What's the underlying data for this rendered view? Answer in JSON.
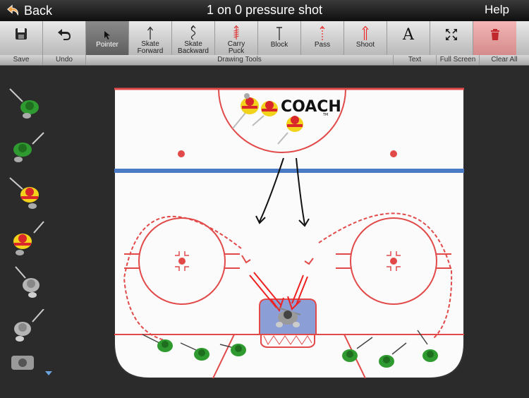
{
  "topbar": {
    "back_label": "Back",
    "title": "1 on 0 pressure shot",
    "help_label": "Help"
  },
  "toolbar": {
    "tools": [
      {
        "label": "Save",
        "icon": "save-icon"
      },
      {
        "label": "Undo",
        "icon": "undo-icon"
      },
      {
        "label": "Pointer",
        "icon": "pointer-icon",
        "selected": true
      },
      {
        "label": "Skate\nForward",
        "icon": "skate-forward-icon"
      },
      {
        "label": "Skate\nBackward",
        "icon": "skate-backward-icon"
      },
      {
        "label": "Carry\nPuck",
        "icon": "carry-puck-icon"
      },
      {
        "label": "Block",
        "icon": "block-icon"
      },
      {
        "label": "Pass",
        "icon": "pass-icon"
      },
      {
        "label": "Shoot",
        "icon": "shoot-icon"
      },
      {
        "label": "A",
        "icon": "text-icon"
      },
      {
        "label": "",
        "icon": "full-screen-icon"
      },
      {
        "label": "",
        "icon": "trash-icon"
      }
    ],
    "groups": {
      "save": "Save",
      "undo": "Undo",
      "drawing": "Drawing Tools",
      "text": "Text",
      "fullscreen": "Full Screen",
      "clear": "Clear All"
    }
  },
  "rink": {
    "logo_text": "COACH",
    "logo_tm": "TM"
  },
  "colors": {
    "rink_red": "#e24a4a",
    "rink_blue": "#4b7bc5",
    "team_green": "#2f9a2f",
    "team_yellow": "#f2d21a",
    "team_red": "#d9262b",
    "goalie_gray": "#9a9a9a",
    "goal_crease": "#8b9fd6"
  },
  "palette": {
    "items": [
      "green-skater-icon",
      "green-skater-icon",
      "yellow-skater-icon",
      "yellow-skater-icon",
      "gray-skater-icon",
      "gray-skater-icon",
      "goalie-icon"
    ]
  }
}
